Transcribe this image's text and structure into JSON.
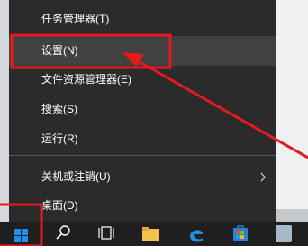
{
  "menu": {
    "items": [
      {
        "label": "任务管理器(T)"
      },
      {
        "label": "设置(N)"
      },
      {
        "label": "文件资源管理器(E)"
      },
      {
        "label": "搜索(S)"
      },
      {
        "label": "运行(R)"
      },
      {
        "label": "关机或注销(U)"
      },
      {
        "label": "桌面(D)"
      }
    ],
    "hovered_item": "设置(N)"
  },
  "taskbar": {
    "icons": [
      "windows-start-icon",
      "search-icon",
      "task-view-icon",
      "file-explorer-icon",
      "edge-icon",
      "store-icon",
      "app-icon"
    ]
  },
  "colors": {
    "menu_bg": "#2b2b2b",
    "menu_hover": "#414141",
    "menu_text": "#ffffff",
    "annotation_red": "#e8191d",
    "windows_blue": "#1e90e8"
  }
}
